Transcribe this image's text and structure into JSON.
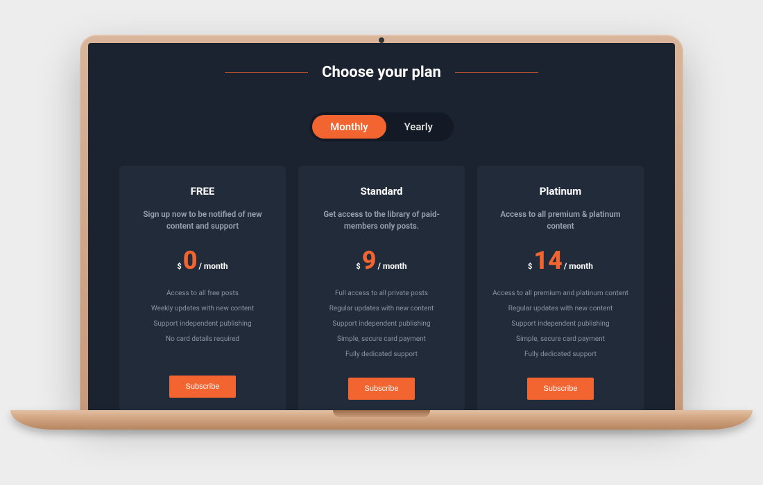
{
  "header": {
    "title": "Choose your plan"
  },
  "toggle": {
    "monthly": "Monthly",
    "yearly": "Yearly"
  },
  "currency": "$",
  "period": "/ month",
  "subscribe_label": "Subscribe",
  "plans": [
    {
      "name": "FREE",
      "description": "Sign up now to be notified of new content and support",
      "price": "0",
      "features": [
        "Access to all free posts",
        "Weekly updates with new content",
        "Support independent publishing",
        "No card details required"
      ]
    },
    {
      "name": "Standard",
      "description": "Get access to the library of paid-members only posts.",
      "price": "9",
      "features": [
        "Full access to all private posts",
        "Regular updates with new content",
        "Support independent publishing",
        "Simple, secure card payment",
        "Fully dedicated support"
      ]
    },
    {
      "name": "Platinum",
      "description": "Access to all premium & platinum content",
      "price": "14",
      "features": [
        "Access to all premium and platinum content",
        "Regular updates with new content",
        "Support independent publishing",
        "Simple, secure card payment",
        "Fully dedicated support"
      ]
    }
  ],
  "colors": {
    "accent": "#f26430",
    "bg_dark": "#1b2330",
    "card": "#222b3a"
  }
}
